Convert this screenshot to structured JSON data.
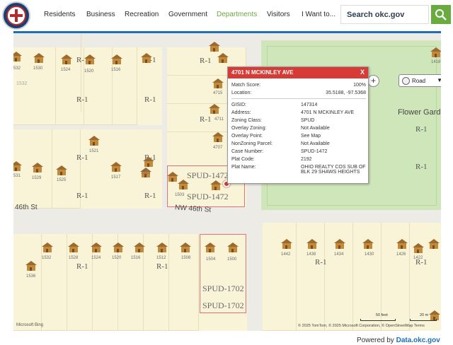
{
  "nav": {
    "items": [
      "Residents",
      "Business",
      "Recreation",
      "Government",
      "Departments",
      "Visitors",
      "I Want to..."
    ],
    "active": "Departments",
    "search_label": "Search okc.gov",
    "search_icon": "magnifier-icon"
  },
  "map": {
    "controls": {
      "locate_icon": "locate-icon",
      "zoom_out": "−",
      "zoom_in": "+",
      "style_select": "Road"
    },
    "streets": [
      "46th St",
      "NW 46th St"
    ],
    "zones": [
      "R-1",
      "SPUD-1472",
      "SPUD-1702"
    ],
    "park_label": "Flower Gard",
    "addresses": [
      "532",
      "1530",
      "1524",
      "1520",
      "1516",
      "1532",
      "4715",
      "4711",
      "4707",
      "1521",
      "531",
      "1529",
      "1525",
      "1517",
      "1513",
      "1503",
      "1532",
      "1528",
      "1524",
      "1520",
      "1516",
      "1512",
      "1508",
      "1504",
      "1500",
      "1536",
      "1442",
      "1438",
      "1434",
      "1430",
      "1426",
      "1422",
      "1418"
    ],
    "attribution": "Microsoft Bing",
    "copyright": "© 2025 TomTom, © 2025 Microsoft Corporation, © OpenStreetMap  Terms",
    "scale": [
      "50 feet",
      "20 m"
    ]
  },
  "popup": {
    "title": "4701 N MCKINLEY AVE",
    "close": "X",
    "match_score_label": "Match Score:",
    "match_score": "100%",
    "location_label": "Location:",
    "location": "35.5188, -97.5368",
    "fields": [
      {
        "k": "GISID:",
        "v": "147314"
      },
      {
        "k": "Address:",
        "v": "4701 N MCKINLEY AVE"
      },
      {
        "k": "Zoning Class:",
        "v": "SPUD"
      },
      {
        "k": "Overlay Zoning:",
        "v": "Not Available"
      },
      {
        "k": "Overlay Point:",
        "v": "See Map"
      },
      {
        "k": "NonZoning Parcel:",
        "v": "Not Available"
      },
      {
        "k": "Case Number:",
        "v": "SPUD-1472"
      },
      {
        "k": "Plat Code:",
        "v": "2192"
      },
      {
        "k": "Plat Name:",
        "v": "OHIO REALTY COS SUB OF BLK 29 SHAWS HEIGHTS"
      }
    ]
  },
  "footer": {
    "powered_by": "Powered by",
    "site": "Data.okc.gov"
  }
}
